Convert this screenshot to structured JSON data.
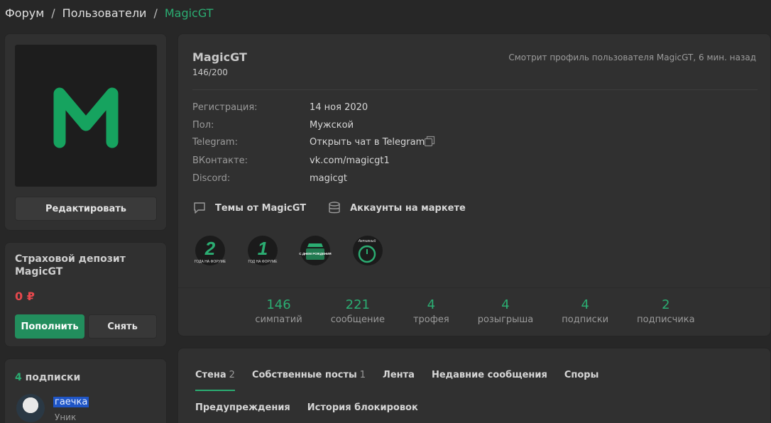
{
  "breadcrumb": {
    "items": [
      "Форум",
      "Пользователи"
    ],
    "current": "MagicGT",
    "separator": "/"
  },
  "avatar": {
    "letter": "M",
    "color": "#16a35f"
  },
  "left": {
    "edit_label": "Редактировать",
    "deposit": {
      "title": "Страховой депозит MagicGT",
      "amount": "0 ₽",
      "fill_label": "Пополнить",
      "withdraw_label": "Снять"
    },
    "subscriptions": {
      "count": "4",
      "label": "подписки",
      "first": {
        "name": "гаечка",
        "role": "Уник"
      }
    }
  },
  "profile": {
    "username": "MagicGT",
    "counter": "146/200",
    "viewing": "Смотрит профиль пользователя MagicGT, 6 мин. назад",
    "info": [
      {
        "key": "Регистрация:",
        "value": "14 ноя 2020"
      },
      {
        "key": "Пол:",
        "value": "Мужской"
      },
      {
        "key": "Telegram:",
        "value": "Открыть чат в Telegram"
      },
      {
        "key": "ВКонтакте:",
        "value": "vk.com/magicgt1"
      },
      {
        "key": "Discord:",
        "value": "magicgt"
      }
    ],
    "links": {
      "themes": "Темы от MagicGT",
      "market": "Аккаунты на маркете"
    },
    "trophies": [
      {
        "big": "2",
        "caption": "ГОДА НА ФОРУМЕ"
      },
      {
        "big": "1",
        "caption": "ГОД НА ФОРУМЕ"
      },
      {
        "caption": "С ДНЕМ РОЖДЕНИЯ"
      },
      {
        "caption": "Активный"
      }
    ],
    "stats": [
      {
        "n": "146",
        "l": "симпатий"
      },
      {
        "n": "221",
        "l": "сообщение"
      },
      {
        "n": "4",
        "l": "трофея"
      },
      {
        "n": "4",
        "l": "розыгрыша"
      },
      {
        "n": "4",
        "l": "подписки"
      },
      {
        "n": "2",
        "l": "подписчика"
      }
    ]
  },
  "tabs": [
    {
      "label": "Стена",
      "count": "2",
      "active": true
    },
    {
      "label": "Собственные посты",
      "count": "1"
    },
    {
      "label": "Лента"
    },
    {
      "label": "Недавние сообщения"
    },
    {
      "label": "Споры"
    },
    {
      "label": "Предупреждения"
    },
    {
      "label": "История блокировок"
    }
  ],
  "colors": {
    "accent": "#2bad72",
    "danger": "#e5484d",
    "button_primary": "#228e5d"
  }
}
